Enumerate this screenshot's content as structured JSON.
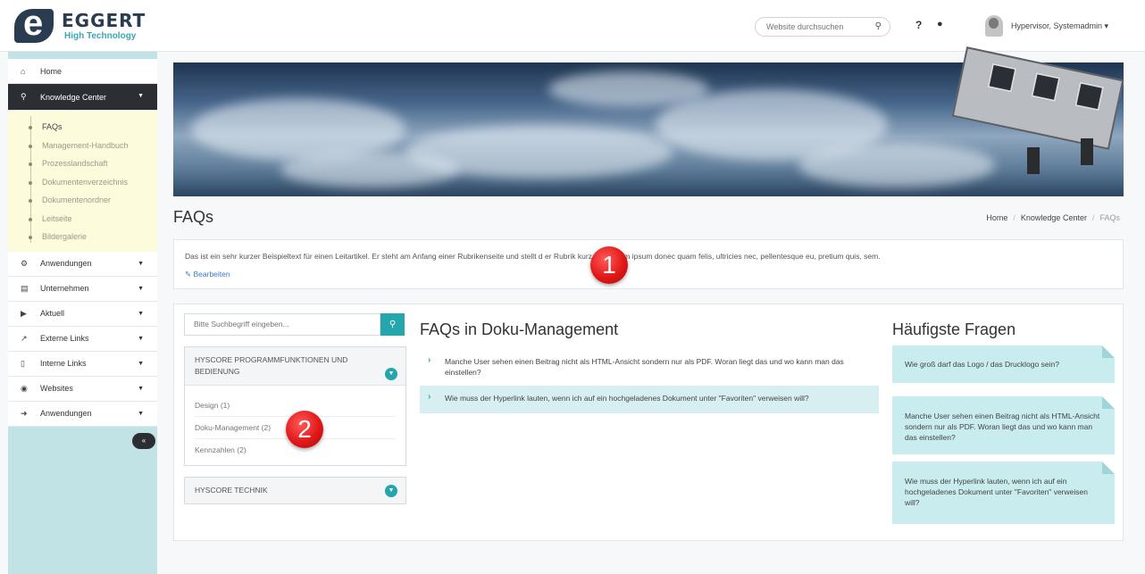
{
  "header": {
    "logo_name": "EGGERT",
    "logo_sub": "High Technology",
    "search_placeholder": "Website durchsuchen",
    "help_label": "?",
    "username": "Hypervisor, Systemadmin ▾"
  },
  "sidebar": {
    "items_top": [
      {
        "label": "Home",
        "icon": "home-icon"
      }
    ],
    "active": {
      "label": "Knowledge Center",
      "icon": "lightbulb-icon"
    },
    "submenu": [
      "FAQs",
      "Management-Handbuch",
      "Prozesslandschaft",
      "Dokumentenverzeichnis",
      "Dokumentenordner",
      "Leitseite",
      "Bildergalerie"
    ],
    "items_bottom": [
      {
        "label": "Anwendungen",
        "icon": "cogs-icon"
      },
      {
        "label": "Unternehmen",
        "icon": "building-icon"
      },
      {
        "label": "Aktuell",
        "icon": "megaphone-icon"
      },
      {
        "label": "Externe Links",
        "icon": "external-link-icon"
      },
      {
        "label": "Interne Links",
        "icon": "bookmark-icon"
      },
      {
        "label": "Websites",
        "icon": "globe-icon"
      },
      {
        "label": "Anwendungen",
        "icon": "sign-in-icon"
      }
    ],
    "collapse_label": "«"
  },
  "page": {
    "title": "FAQs",
    "breadcrumb": [
      "Home",
      "Knowledge Center",
      "FAQs"
    ],
    "breadcrumb_sep": "/"
  },
  "intro": {
    "text": "Das ist ein sehr kurzer Beispieltext für einen Leitartikel. Er steht am Anfang einer Rubrikenseite und stellt d                    er Rubrik kurz vor. Lorem ipsum donec quam felis, ultricies nec, pellentesque eu, pretium quis, sem.",
    "edit_label": "Bearbeiten"
  },
  "markers": [
    "1",
    "2"
  ],
  "kb": {
    "search_placeholder": "Bitte Suchbegriff eingeben...",
    "accordion": [
      {
        "title": "HYSCORE PROGRAMMFUNKTIONEN UND BEDIENUNG",
        "rows": [
          "Design (1)",
          "Doku-Management (2)",
          "Kennzahlen (2)"
        ]
      },
      {
        "title": "HYSCORE TECHNIK",
        "rows": []
      }
    ]
  },
  "faqs": {
    "heading": "FAQs in Doku-Management",
    "items": [
      "Manche User sehen einen Beitrag nicht als HTML-Ansicht sondern nur als PDF. Woran liegt das und wo kann man das einstellen?",
      "Wie muss der Hyperlink lauten, wenn ich auf ein hochgeladenes Dokument unter \"Favoriten\" verweisen will?"
    ]
  },
  "top_questions": {
    "heading": "Häufigste Fragen",
    "cards": [
      "Wie groß darf das Logo / das Drucklogo sein?",
      "Manche User sehen einen Beitrag nicht als HTML-Ansicht sondern nur als PDF. Woran liegt das und wo kann man das einstellen?",
      "Wie muss der Hyperlink lauten, wenn ich auf ein hochgeladenes Dokument unter \"Favoriten\" verweisen will?"
    ]
  },
  "colors": {
    "accent": "#25a6ad",
    "sidebar_bg": "#c2e3e5",
    "active_nav": "#2b2f33",
    "card_bg": "#c9ecee",
    "marker_red": "#e21818"
  }
}
